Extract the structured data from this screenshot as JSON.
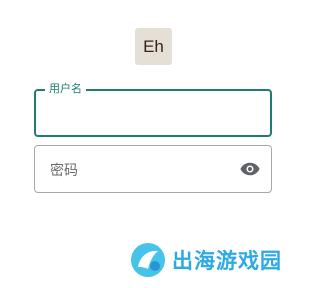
{
  "logo": {
    "text": "Eh"
  },
  "username": {
    "label": "用户名",
    "value": ""
  },
  "password": {
    "placeholder": "密码",
    "value": ""
  },
  "icons": {
    "visibility": "eye-icon"
  },
  "watermark": {
    "text": "出海游戏园"
  },
  "colors": {
    "accent": "#1f7d72",
    "border": "#a8a8a8",
    "logo_bg": "#e4e0d6",
    "watermark": "#22a6e0"
  }
}
